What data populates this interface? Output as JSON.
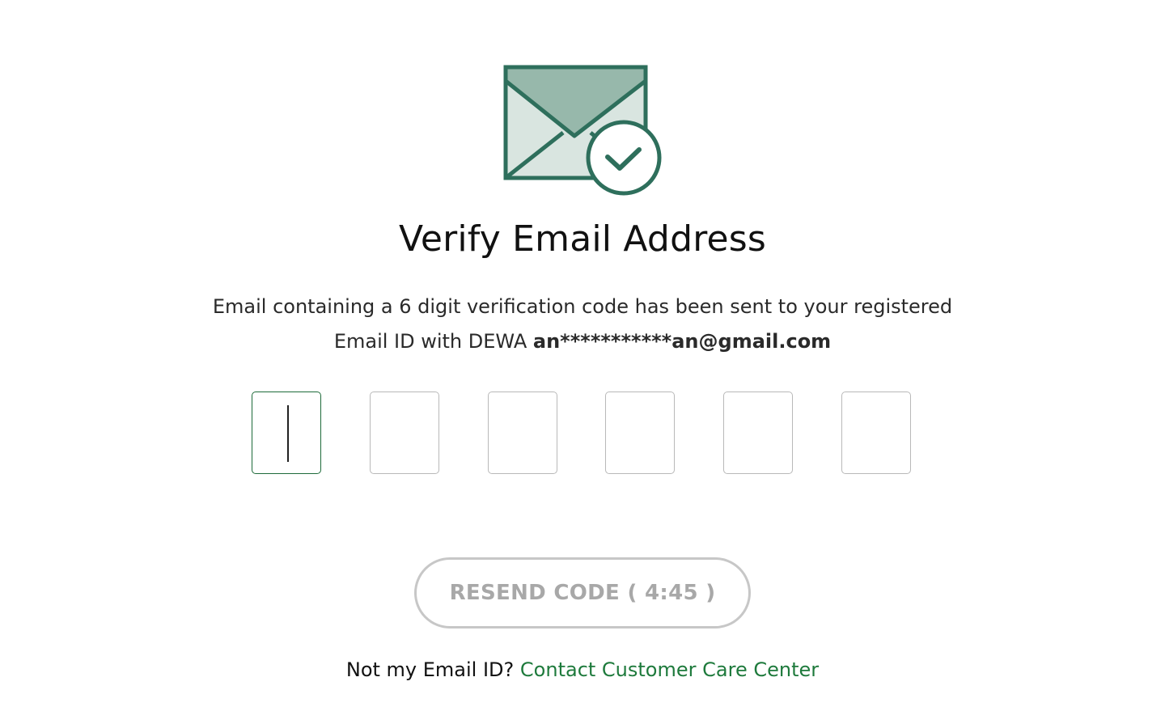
{
  "header": {
    "title": "Verify Email Address",
    "icon": "email-verified-icon"
  },
  "message": {
    "line1": "Email containing a 6 digit verification code has been sent to your registered",
    "line2_prefix": "Email ID with DEWA",
    "masked_email": "an***********an@gmail.com"
  },
  "otp": {
    "digits": [
      "",
      "",
      "",
      "",
      "",
      ""
    ],
    "active_index": 0
  },
  "resend": {
    "label": "RESEND CODE ( 4:45 )"
  },
  "footer": {
    "question": "Not my Email ID?",
    "link_label": "Contact Customer Care Center"
  },
  "colors": {
    "brand_green": "#2e6f5c",
    "envelope_flap": "#97b8ab",
    "envelope_body": "#d9e5e0",
    "link_green": "#1e7a3c",
    "active_border": "#1e6b3a",
    "disabled_gray": "#a8a8a8"
  }
}
